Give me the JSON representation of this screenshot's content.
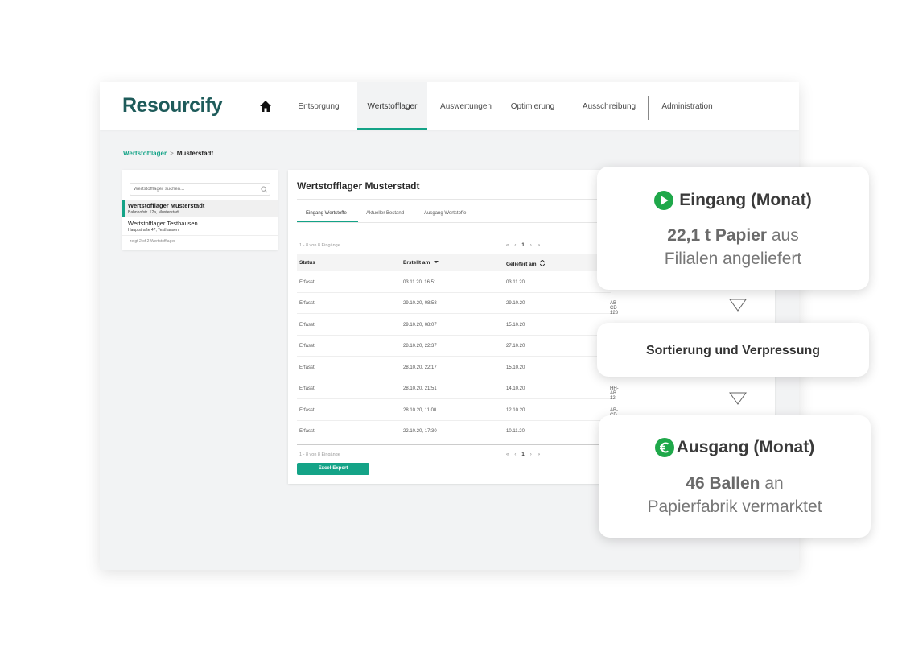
{
  "nav": {
    "logo": "Resourcify",
    "items": [
      "Entsorgung",
      "Wertstofflager",
      "Auswertungen",
      "Optimierung",
      "Ausschreibung",
      "Administration"
    ],
    "active_index": 1
  },
  "breadcrumb": {
    "parent": "Wertstofflager",
    "separator": ">",
    "current": "Musterstadt"
  },
  "sidebar": {
    "search_placeholder": "Wertstofflager suchen...",
    "items": [
      {
        "name": "Wertstofflager Musterstadt",
        "address": "Bahnhofstr. 12a, Musterstadt",
        "selected": true
      },
      {
        "name": "Wertstofflager Testhausen",
        "address": "Hauptstraße 47, Testhausen",
        "selected": false
      }
    ],
    "footer": "zeigt 2 of 2 Wertstofflager"
  },
  "main": {
    "title": "Wertstofflager Musterstadt",
    "tabs": [
      "Eingang Wertstoffe",
      "Aktueller Bestand",
      "Ausgang Wertstoffe"
    ],
    "count_label": "1 - 8 von 8 Eingänge",
    "pager": {
      "first": "«",
      "prev": "‹",
      "page": "1",
      "next": "›",
      "last": "»"
    },
    "columns": [
      "Status",
      "Erstellt am",
      "Geliefert am"
    ],
    "rows": [
      {
        "status": "Erfasst",
        "created": "03.11.20, 16:51",
        "delivered": "03.11.20",
        "extra": ""
      },
      {
        "status": "Erfasst",
        "created": "29.10.20, 08:58",
        "delivered": "29.10.20",
        "extra": "AB-CD 123"
      },
      {
        "status": "Erfasst",
        "created": "29.10.20, 08:07",
        "delivered": "15.10.20",
        "extra": ""
      },
      {
        "status": "Erfasst",
        "created": "28.10.20, 22:37",
        "delivered": "27.10.20",
        "extra": ""
      },
      {
        "status": "Erfasst",
        "created": "28.10.20, 22:17",
        "delivered": "15.10.20",
        "extra": ""
      },
      {
        "status": "Erfasst",
        "created": "28.10.20, 21:51",
        "delivered": "14.10.20",
        "extra": "HH-AB 12"
      },
      {
        "status": "Erfasst",
        "created": "28.10.20, 11:00",
        "delivered": "12.10.20",
        "extra": "AB-CD 12"
      },
      {
        "status": "Erfasst",
        "created": "22.10.20, 17:30",
        "delivered": "10.11.20",
        "extra": ""
      }
    ],
    "export_label": "Excel-Export"
  },
  "flow": {
    "incoming": {
      "title": "Eingang (Monat)",
      "amount": "22,1 t Papier",
      "text_after": "aus",
      "line2": "Filialen angeliefert"
    },
    "process": {
      "title": "Sortierung und Verpressung"
    },
    "outgoing": {
      "title": "Ausgang (Monat)",
      "amount": "46 Ballen",
      "text_after": "an",
      "line2": "Papierfabrik vermarktet"
    }
  },
  "colors": {
    "brand": "#1e5b5a",
    "accent": "#14a387",
    "play_icon": "#1fa84a"
  }
}
